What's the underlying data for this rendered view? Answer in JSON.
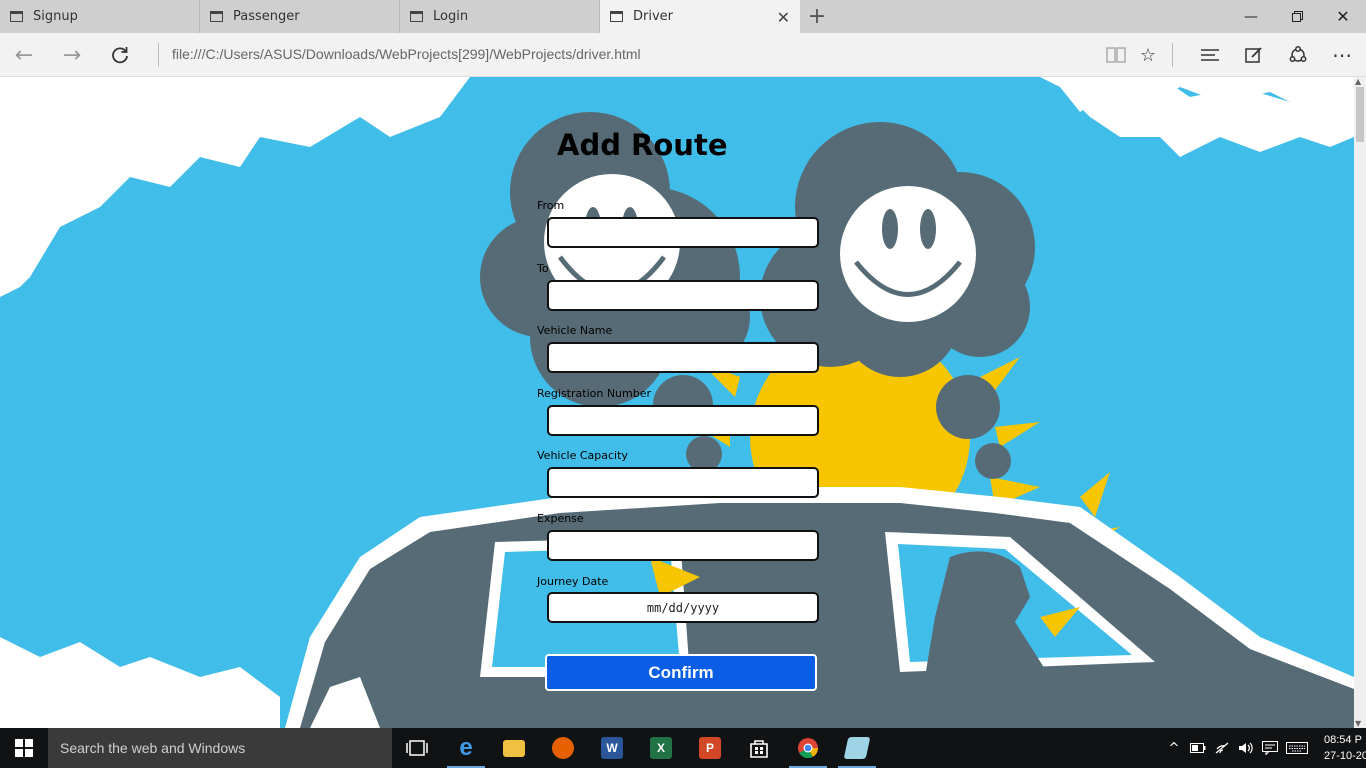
{
  "browser": {
    "tabs": [
      {
        "title": "Signup",
        "active": false
      },
      {
        "title": "Passenger",
        "active": false
      },
      {
        "title": "Login",
        "active": false
      },
      {
        "title": "Driver",
        "active": true
      }
    ],
    "url": "file:///C:/Users/ASUS/Downloads/WebProjects[299]/WebProjects/driver.html"
  },
  "form": {
    "title": "Add Route",
    "fields": [
      {
        "label": "From",
        "value": ""
      },
      {
        "label": "To",
        "value": ""
      },
      {
        "label": "Vehicle Name",
        "value": ""
      },
      {
        "label": "Registration Number",
        "value": ""
      },
      {
        "label": "Vehicle Capacity",
        "value": ""
      },
      {
        "label": "Expense",
        "value": ""
      },
      {
        "label": "Journey Date",
        "value": "mm/dd/yyyy"
      }
    ],
    "submit_label": "Confirm"
  },
  "taskbar": {
    "search_placeholder": "Search the web and Windows",
    "apps": [
      "task-view",
      "edge",
      "file-explorer",
      "firefox",
      "word",
      "excel",
      "powerpoint",
      "store",
      "chrome",
      "notepad"
    ],
    "clock_time": "08:54 P",
    "clock_date": "27-10-20"
  },
  "colors": {
    "sky": "#40bde8",
    "cloud_gray": "#566b76",
    "sun": "#f7c600",
    "confirm_button": "#0a5ee6"
  }
}
